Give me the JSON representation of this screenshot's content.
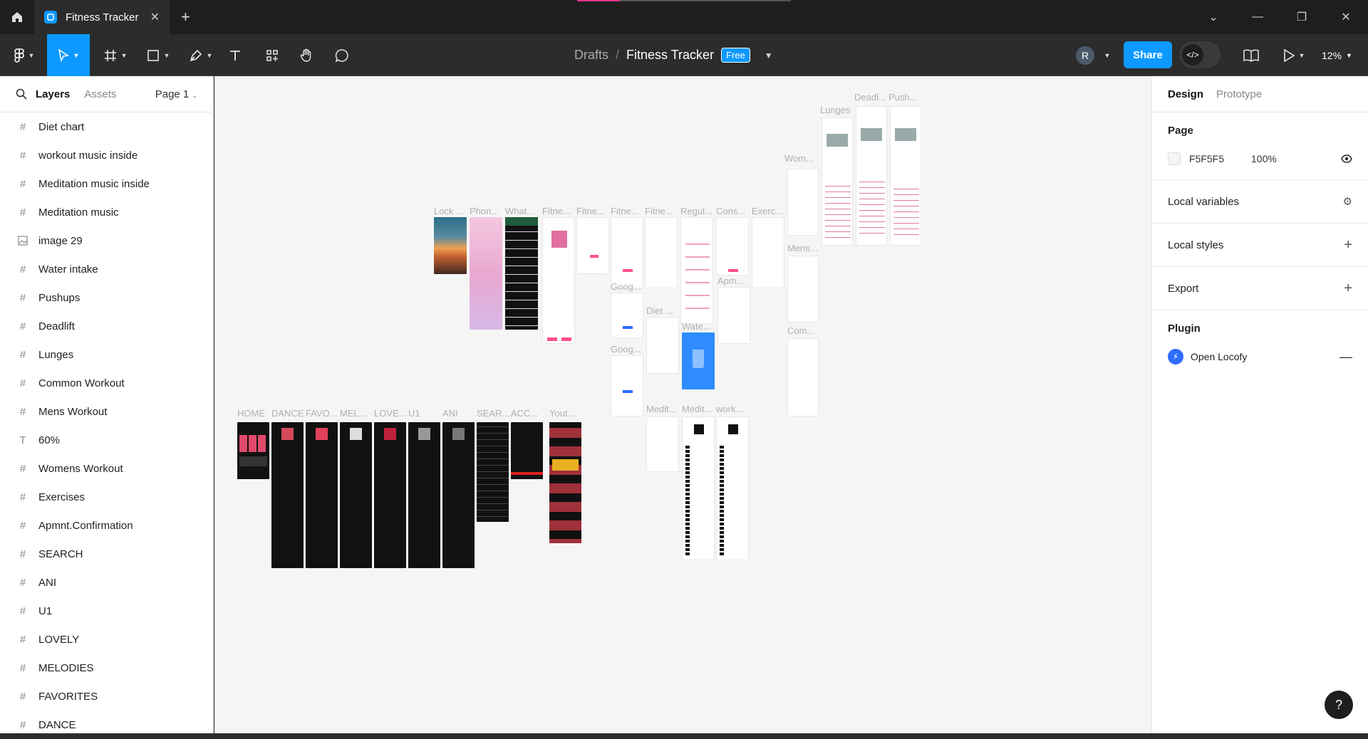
{
  "titlebar": {
    "tab_title": "Fitness Tracker",
    "tab_close": "✕",
    "new_tab": "+",
    "minimize": "—",
    "restore": "❐",
    "close": "✕"
  },
  "toolbar": {
    "breadcrumb_parent": "Drafts",
    "breadcrumb_sep": "/",
    "file_name": "Fitness Tracker",
    "plan_badge": "Free",
    "avatar_initial": "R",
    "share_label": "Share",
    "zoom": "12%"
  },
  "left_panel": {
    "tab_layers": "Layers",
    "tab_assets": "Assets",
    "page_selector": "Page 1",
    "layers": [
      {
        "name": "Diet chart",
        "icon": "frame-icon"
      },
      {
        "name": "workout music inside",
        "icon": "frame-icon"
      },
      {
        "name": "Meditation music inside",
        "icon": "frame-icon"
      },
      {
        "name": "Meditation music",
        "icon": "frame-icon"
      },
      {
        "name": "image 29",
        "icon": "image-icon"
      },
      {
        "name": "Water intake",
        "icon": "frame-icon"
      },
      {
        "name": "Pushups",
        "icon": "frame-icon"
      },
      {
        "name": "Deadlift",
        "icon": "frame-icon"
      },
      {
        "name": "Lunges",
        "icon": "frame-icon"
      },
      {
        "name": "Common Workout",
        "icon": "frame-icon"
      },
      {
        "name": "Mens Workout",
        "icon": "frame-icon"
      },
      {
        "name": "60%",
        "icon": "text-icon"
      },
      {
        "name": "Womens Workout",
        "icon": "frame-icon"
      },
      {
        "name": "Exercises",
        "icon": "frame-icon"
      },
      {
        "name": "Apmnt.Confirmation",
        "icon": "frame-icon"
      },
      {
        "name": "SEARCH",
        "icon": "frame-icon"
      },
      {
        "name": "ANI",
        "icon": "frame-icon"
      },
      {
        "name": "U1",
        "icon": "frame-icon"
      },
      {
        "name": "LOVELY",
        "icon": "frame-icon"
      },
      {
        "name": "MELODIES",
        "icon": "frame-icon"
      },
      {
        "name": "FAVORITES",
        "icon": "frame-icon"
      },
      {
        "name": "DANCE",
        "icon": "frame-icon"
      }
    ]
  },
  "canvas": {
    "background": "#F5F5F5",
    "frame_labels": {
      "home": "HOME",
      "dance": "DANCE",
      "favo": "FAVO...",
      "mel": "MEL...",
      "love": "LOVE...",
      "u1": "U1",
      "ani": "ANI",
      "sear": "SEAR...",
      "acc": "ACC...",
      "yout": "Yout...",
      "lock": "Lock ...",
      "phon": "Phon...",
      "what": "What...",
      "fitne1": "Fitne...",
      "fitne2": "Fitne...",
      "fitne3": "Fitne...",
      "fitne4": "Fitne...",
      "regul": "Regul...",
      "cons": "Cons...",
      "exerc": "Exerc...",
      "goog1": "Goog...",
      "goog2": "Goog...",
      "diet": "Diet ...",
      "wate": "Wate...",
      "apmnt": "Apm...",
      "wom": "Wom...",
      "mens": "Mens...",
      "com": "Com...",
      "lunges": "Lunges",
      "deadl": "Deadl...",
      "push": "Push...",
      "medit1": "Medit...",
      "medit2": "Medit...",
      "work": "work..."
    }
  },
  "right_panel": {
    "tab_design": "Design",
    "tab_prototype": "Prototype",
    "page_title": "Page",
    "page_color": "F5F5F5",
    "page_opacity": "100%",
    "local_variables": "Local variables",
    "local_styles": "Local styles",
    "export": "Export",
    "plugin_title": "Plugin",
    "plugin_name": "Open Locofy"
  },
  "help": "?"
}
